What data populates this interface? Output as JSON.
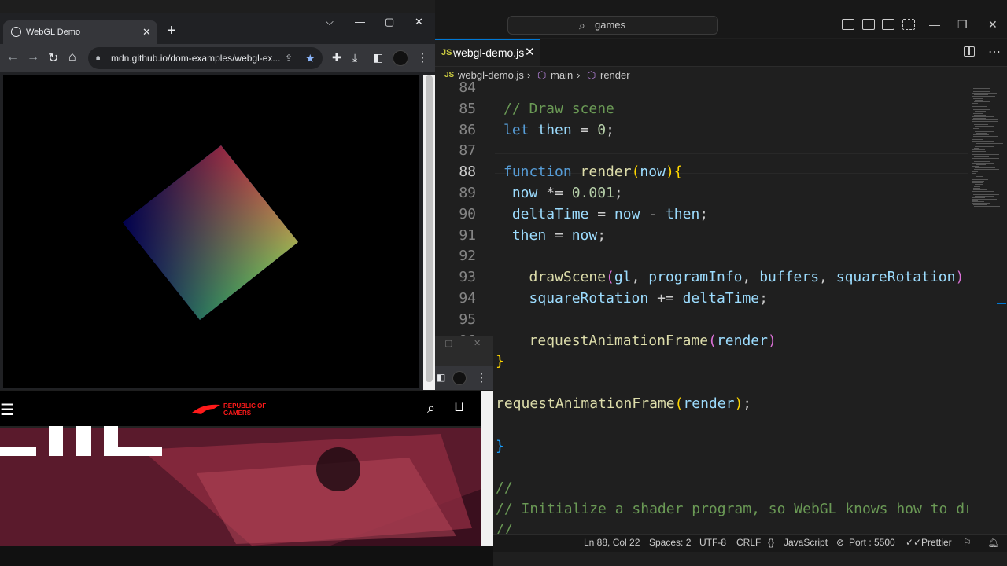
{
  "vscode": {
    "search": "games",
    "tab": {
      "lang": "JS",
      "name": "webgl-demo.js"
    },
    "breadcrumb": [
      {
        "label": "JS",
        "kind": "lang"
      },
      {
        "label": "webgl-demo.js"
      },
      {
        "label": "main"
      },
      {
        "label": "render"
      }
    ],
    "lines": [
      {
        "n": "84",
        "tokens": []
      },
      {
        "n": "85",
        "tokens": [
          [
            "cm",
            "// Draw scene"
          ]
        ]
      },
      {
        "n": "86",
        "tokens": [
          [
            "kw",
            "let"
          ],
          [
            "",
            " "
          ],
          [
            "var",
            "then"
          ],
          [
            "",
            " = "
          ],
          [
            "num",
            "0"
          ],
          [
            "",
            ";"
          ]
        ]
      },
      {
        "n": "87",
        "tokens": []
      },
      {
        "n": "88",
        "tokens": [
          [
            "kw",
            "function"
          ],
          [
            "",
            " "
          ],
          [
            "fn",
            "render"
          ],
          [
            "br1",
            "("
          ],
          [
            "var",
            "now"
          ],
          [
            "br1",
            ")"
          ],
          [
            "br1",
            "{"
          ]
        ]
      },
      {
        "n": "89",
        "tokens": [
          [
            "",
            " "
          ],
          [
            "var",
            "now"
          ],
          [
            "",
            " *= "
          ],
          [
            "num",
            "0.001"
          ],
          [
            "",
            ";"
          ]
        ]
      },
      {
        "n": "90",
        "tokens": [
          [
            "",
            " "
          ],
          [
            "var",
            "deltaTime"
          ],
          [
            "",
            " = "
          ],
          [
            "var",
            "now"
          ],
          [
            "",
            " - "
          ],
          [
            "var",
            "then"
          ],
          [
            "",
            ";"
          ]
        ]
      },
      {
        "n": "91",
        "tokens": [
          [
            "",
            " "
          ],
          [
            "var",
            "then"
          ],
          [
            "",
            " = "
          ],
          [
            "var",
            "now"
          ],
          [
            "",
            ";"
          ]
        ]
      },
      {
        "n": "92",
        "tokens": []
      },
      {
        "n": "93",
        "tokens": [
          [
            "",
            "   "
          ],
          [
            "fn",
            "drawScene"
          ],
          [
            "br2",
            "("
          ],
          [
            "var",
            "gl"
          ],
          [
            "",
            ", "
          ],
          [
            "var",
            "programInfo"
          ],
          [
            "",
            ", "
          ],
          [
            "var",
            "buffers"
          ],
          [
            "",
            ", "
          ],
          [
            "var",
            "squareRotation"
          ],
          [
            "br2",
            ")"
          ]
        ]
      },
      {
        "n": "94",
        "tokens": [
          [
            "",
            "   "
          ],
          [
            "var",
            "squareRotation"
          ],
          [
            "",
            " += "
          ],
          [
            "var",
            "deltaTime"
          ],
          [
            "",
            ";"
          ]
        ]
      },
      {
        "n": "95",
        "tokens": []
      },
      {
        "n": "96",
        "tokens": [
          [
            "",
            "   "
          ],
          [
            "fn",
            "requestAnimationFrame"
          ],
          [
            "br2",
            "("
          ],
          [
            "var",
            "render"
          ],
          [
            "br2",
            ")"
          ]
        ]
      },
      {
        "n": "",
        "tokens": [
          [
            "br1",
            "}"
          ]
        ]
      },
      {
        "n": "",
        "tokens": []
      },
      {
        "n": "",
        "tokens": [
          [
            "fn",
            "requestAnimationFrame"
          ],
          [
            "br1",
            "("
          ],
          [
            "var",
            "render"
          ],
          [
            "br1",
            ")"
          ],
          [
            "",
            ";"
          ]
        ]
      },
      {
        "n": "",
        "tokens": []
      },
      {
        "n": "",
        "tokens": [
          [
            "br3",
            "}"
          ]
        ]
      },
      {
        "n": "",
        "tokens": []
      },
      {
        "n": "",
        "tokens": [
          [
            "cm",
            "//"
          ]
        ]
      },
      {
        "n": "",
        "tokens": [
          [
            "cm",
            "// Initialize a shader program, so WebGL knows how to dr"
          ]
        ]
      },
      {
        "n": "",
        "tokens": [
          [
            "cm",
            "//"
          ]
        ]
      }
    ],
    "current_line": "88",
    "status": {
      "position": "Ln 88, Col 22",
      "spaces": "Spaces: 2",
      "encoding": "UTF-8",
      "eol": "CRLF",
      "language": "JavaScript",
      "port": "Port : 5500",
      "formatter": "Prettier"
    }
  },
  "chrome": {
    "tab_title": "WebGL Demo",
    "url": "mdn.github.io/dom-examples/webgl-ex..."
  },
  "rog": {
    "logo_line1": "REPUBLIC OF",
    "logo_line2": "GAMERS"
  },
  "colors": {
    "vscode_bg": "#1f1f1f",
    "accent": "#0078d4",
    "rog_red": "#ff1a1a"
  }
}
